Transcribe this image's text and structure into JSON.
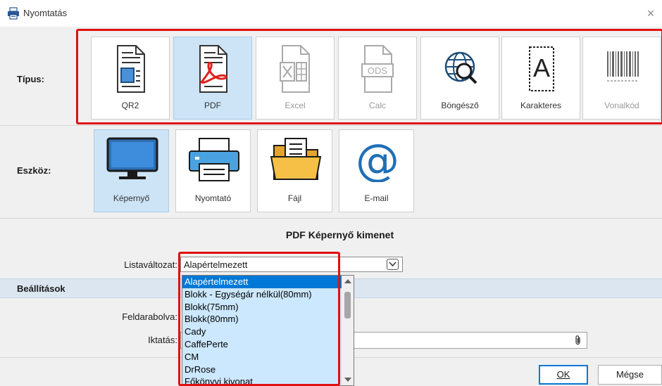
{
  "window": {
    "title": "Nyomtatás",
    "close_glyph": "×"
  },
  "type_row": {
    "label": "Típus:",
    "tiles": [
      {
        "label": "QR2",
        "icon": "qr2-document-icon",
        "selected": false
      },
      {
        "label": "PDF",
        "icon": "pdf-document-icon",
        "selected": true
      },
      {
        "label": "Excel",
        "icon": "excel-document-icon",
        "disabled": true
      },
      {
        "label": "Calc",
        "icon": "ods-document-icon",
        "disabled": true
      },
      {
        "label": "Böngésző",
        "icon": "browser-globe-icon"
      },
      {
        "label": "Karakteres",
        "icon": "character-document-icon"
      },
      {
        "label": "Vonalkód",
        "icon": "barcode-icon",
        "disabled": true
      }
    ]
  },
  "device_row": {
    "label": "Eszköz:",
    "tiles": [
      {
        "label": "Képernyő",
        "icon": "monitor-icon",
        "selected": true
      },
      {
        "label": "Nyomtató",
        "icon": "printer-icon"
      },
      {
        "label": "Fájl",
        "icon": "folder-icon"
      },
      {
        "label": "E-mail",
        "icon": "at-sign-icon"
      }
    ]
  },
  "output_title": "PDF Képernyő kimenet",
  "list_variant": {
    "label": "Listaváltozat:",
    "value": "Alapértelmezett"
  },
  "settings": {
    "header": "Beállítások",
    "split_label": "Feldarabolva:",
    "filing_label": "Iktatás:"
  },
  "dropdown": {
    "items": [
      "Alapértelmezett",
      "Blokk - Egységár nélkül(80mm)",
      "Blokk(75mm)",
      "Blokk(80mm)",
      "Cady",
      "CaffePerte",
      "CM",
      "DrRose",
      "Főkönyvi kivonat"
    ],
    "selected_index": 0
  },
  "buttons": {
    "ok": "OK",
    "cancel": "Mégse"
  },
  "colors": {
    "selection_blue": "#0078d7",
    "highlight_red": "#e01010",
    "selected_tile": "#cde4f7"
  }
}
